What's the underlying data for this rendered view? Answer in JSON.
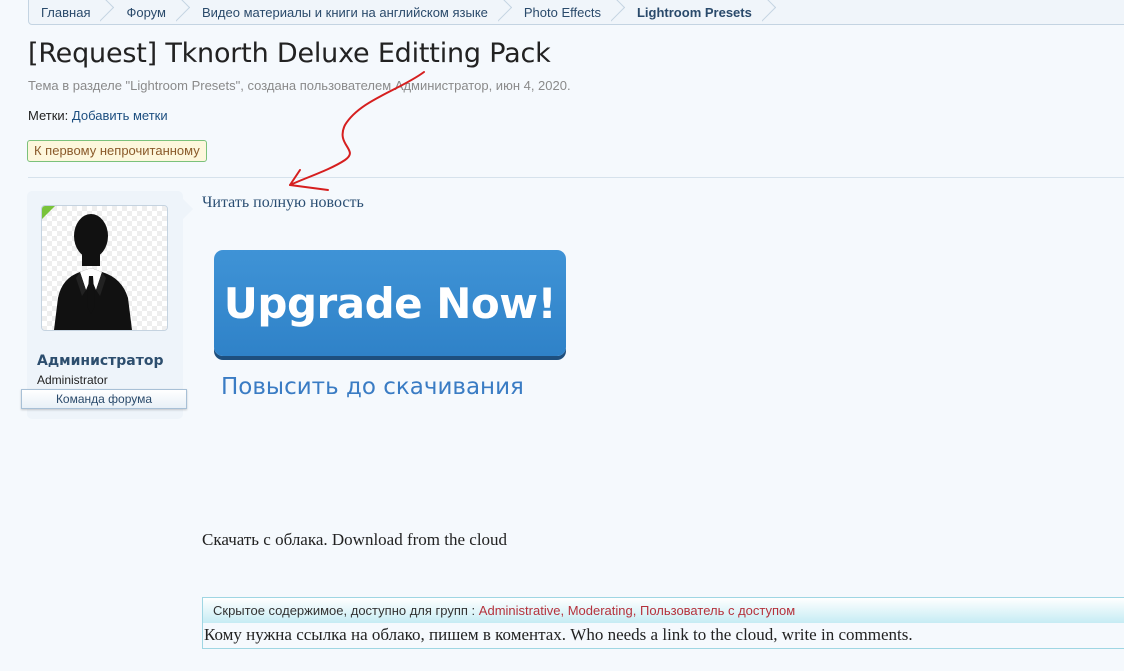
{
  "breadcrumb": {
    "items": [
      "Главная",
      "Форум",
      "Видео материалы и книги на английском языке",
      "Photo Effects",
      "Lightroom Presets"
    ]
  },
  "thread": {
    "title": "[Request] Tknorth Deluxe Editting Pack",
    "meta": "Тема в разделе \"Lightroom Presets\", создана пользователем Администратор, июн 4, 2020.",
    "tags_label": "Метки:",
    "tags_add": "Добавить метки",
    "first_unread": "К первому непрочитанному"
  },
  "user": {
    "name": "Администратор",
    "title": "Administrator",
    "banner": "Команда форума"
  },
  "post": {
    "read_full": "Читать полную новость",
    "upgrade_button": "Upgrade Now!",
    "upgrade_caption": "Повысить до скачивания",
    "download_text": "Скачать с облака. Download from the cloud",
    "hidden": {
      "prefix": "Скрытое содержимое, доступно для групп :",
      "groups": [
        "Administrative",
        "Moderating",
        "Пользователь с доступом"
      ],
      "body": "Кому нужна ссылка на облако, пишем в коментах. Who needs a link to the cloud, write in comments."
    }
  },
  "colors": {
    "link": "#1d4f80",
    "group": "#b5323c",
    "button": "#3a8bd0",
    "annotation": "#d61f1f"
  }
}
